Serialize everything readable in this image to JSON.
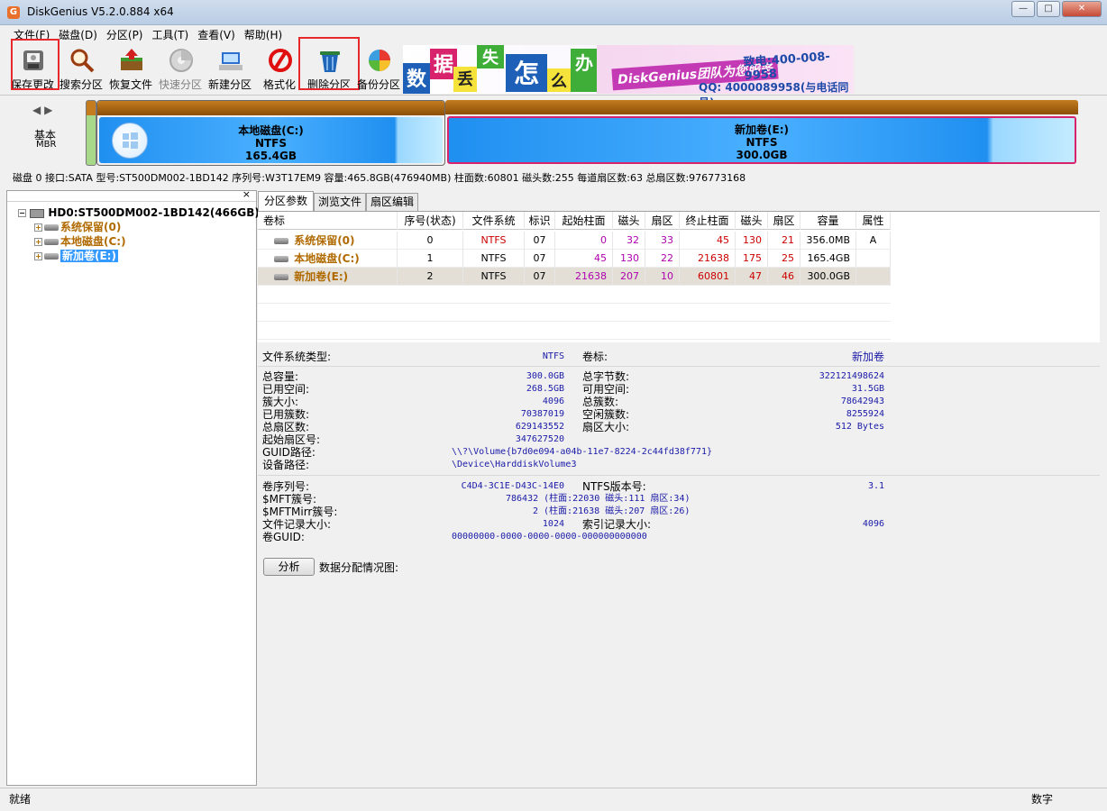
{
  "window": {
    "title": "DiskGenius V5.2.0.884 x64",
    "icon": "diskgenius-app-icon"
  },
  "menu": [
    "文件(F)",
    "磁盘(D)",
    "分区(P)",
    "工具(T)",
    "查看(V)",
    "帮助(H)"
  ],
  "toolbar": [
    {
      "label": "保存更改",
      "icon": "save-disk-icon",
      "enabled": true,
      "highlighted": true
    },
    {
      "label": "搜索分区",
      "icon": "magnifier-icon",
      "enabled": true
    },
    {
      "label": "恢复文件",
      "icon": "recover-box-icon",
      "enabled": true
    },
    {
      "label": "快速分区",
      "icon": "quick-partition-icon",
      "enabled": false
    },
    {
      "label": "新建分区",
      "icon": "new-partition-icon",
      "enabled": true
    },
    {
      "label": "格式化",
      "icon": "format-icon",
      "enabled": true
    },
    {
      "label": "删除分区",
      "icon": "trash-bin-icon",
      "enabled": true,
      "highlighted": true
    },
    {
      "label": "备份分区",
      "icon": "backup-pie-icon",
      "enabled": true
    }
  ],
  "banner": {
    "tiles": [
      "数",
      "据",
      "丢",
      "失",
      "怎",
      "么",
      "办"
    ],
    "slogan": "DiskGenius团队为您服务",
    "phone": "400-008-9958",
    "phone_label": "致电:",
    "qq": "QQ: 4000089958(与电话同号)"
  },
  "diskmap": {
    "type": "基本",
    "style": "MBR",
    "partitions": [
      {
        "name": "本地磁盘(C:)",
        "fs": "NTFS",
        "size": "165.4GB"
      },
      {
        "name": "新加卷(E:)",
        "fs": "NTFS",
        "size": "300.0GB"
      }
    ]
  },
  "disk_info": "磁盘 0 接口:SATA  型号:ST500DM002-1BD142  序列号:W3T17EM9  容量:465.8GB(476940MB)  柱面数:60801  磁头数:255  每道扇区数:63  总扇区数:976773168",
  "tree": {
    "root": "HD0:ST500DM002-1BD142(466GB)",
    "partitions": [
      "系统保留(0)",
      "本地磁盘(C:)",
      "新加卷(E:)"
    ],
    "selected": 2
  },
  "tabs": [
    "分区参数",
    "浏览文件",
    "扇区编辑"
  ],
  "partition_table": {
    "columns": [
      "卷标",
      "序号(状态)",
      "文件系统",
      "标识",
      "起始柱面",
      "磁头",
      "扇区",
      "终止柱面",
      "磁头",
      "扇区",
      "容量",
      "属性"
    ],
    "rows": [
      {
        "label": "系统保留(0)",
        "index": "0",
        "fs": "NTFS",
        "id": "07",
        "start_cyl": "0",
        "start_head": "32",
        "start_sec": "33",
        "end_cyl": "45",
        "end_head": "130",
        "end_sec": "21",
        "capacity": "356.0MB",
        "attr": "A"
      },
      {
        "label": "本地磁盘(C:)",
        "index": "1",
        "fs": "NTFS",
        "id": "07",
        "start_cyl": "45",
        "start_head": "130",
        "start_sec": "22",
        "end_cyl": "21638",
        "end_head": "175",
        "end_sec": "25",
        "capacity": "165.4GB",
        "attr": ""
      },
      {
        "label": "新加卷(E:)",
        "index": "2",
        "fs": "NTFS",
        "id": "07",
        "start_cyl": "21638",
        "start_head": "207",
        "start_sec": "10",
        "end_cyl": "60801",
        "end_head": "47",
        "end_sec": "46",
        "capacity": "300.0GB",
        "attr": ""
      }
    ]
  },
  "details": {
    "fs_type_label": "文件系统类型:",
    "fs_type": "NTFS",
    "volume_label_label": "卷标:",
    "volume_label": "新加卷",
    "total_capacity_label": "总容量:",
    "total_capacity": "300.0GB",
    "total_bytes_label": "总字节数:",
    "total_bytes": "322121498624",
    "used_space_label": "已用空间:",
    "used_space": "268.5GB",
    "free_space_label": "可用空间:",
    "free_space": "31.5GB",
    "cluster_size_label": "簇大小:",
    "cluster_size": "4096",
    "total_clusters_label": "总簇数:",
    "total_clusters": "78642943",
    "used_clusters_label": "已用簇数:",
    "used_clusters": "70387019",
    "free_clusters_label": "空闲簇数:",
    "free_clusters": "8255924",
    "total_sectors_label": "总扇区数:",
    "total_sectors": "629143552",
    "sector_size_label": "扇区大小:",
    "sector_size": "512 Bytes",
    "start_sector_label": "起始扇区号:",
    "start_sector": "347627520",
    "guid_path_label": "GUID路径:",
    "guid_path": "\\\\?\\Volume{b7d0e094-a04b-11e7-8224-2c44fd38f771}",
    "device_path_label": "设备路径:",
    "device_path": "\\Device\\HarddiskVolume3",
    "serial_label": "卷序列号:",
    "serial": "C4D4-3C1E-D43C-14E0",
    "ntfs_version_label": "NTFS版本号:",
    "ntfs_version": "3.1",
    "mft_label": "$MFT簇号:",
    "mft": "786432 (柱面:22030 磁头:111 扇区:34)",
    "mftmirr_label": "$MFTMirr簇号:",
    "mftmirr": "2 (柱面:21638 磁头:207 扇区:26)",
    "file_record_label": "文件记录大小:",
    "file_record": "1024",
    "index_record_label": "索引记录大小:",
    "index_record": "4096",
    "volume_guid_label": "卷GUID:",
    "volume_guid": "00000000-0000-0000-0000-000000000000",
    "analyze_button": "分析",
    "alloc_label": "数据分配情况图:"
  },
  "status": {
    "left": "就绪",
    "right": "数字"
  },
  "colors": {
    "partition_name": "#b06a00",
    "value_blue": "#1a1aa8",
    "highlight_red": "#e8282a",
    "selected_partition_border": "#d8226b"
  }
}
